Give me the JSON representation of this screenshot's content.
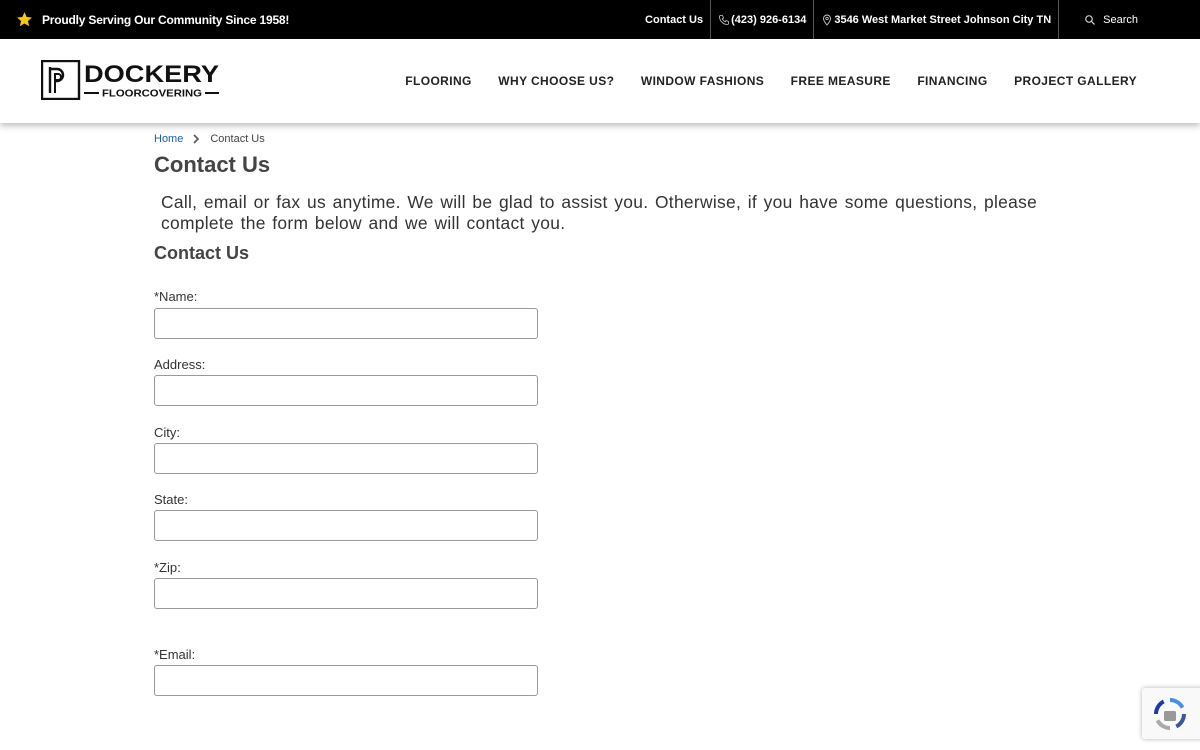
{
  "topbar": {
    "tagline": "Proudly Serving Our Community Since 1958!",
    "contact_link": "Contact Us",
    "phone": "(423) 926-6134",
    "address": "3546 West Market Street Johnson City TN",
    "search_label": "Search"
  },
  "logo": {
    "name": "DOCKERY",
    "tagline": "FLOORCOVERING"
  },
  "nav": {
    "items": [
      {
        "label": "FLOORING"
      },
      {
        "label": "WHY CHOOSE US?"
      },
      {
        "label": "WINDOW FASHIONS"
      },
      {
        "label": "FREE MEASURE"
      },
      {
        "label": "FINANCING"
      },
      {
        "label": "PROJECT GALLERY"
      }
    ]
  },
  "breadcrumb": {
    "home": "Home",
    "current": "Contact Us"
  },
  "page_title": "Contact Us",
  "intro_text": "Call, email or fax us anytime. We will be glad to assist you. Otherwise, if you have some questions, please complete the form below and we will contact you.",
  "form": {
    "heading": "Contact Us",
    "fields": [
      {
        "label": "*Name:",
        "value": ""
      },
      {
        "label": "Address:",
        "value": ""
      },
      {
        "label": "City:",
        "value": ""
      },
      {
        "label": "State:",
        "value": ""
      },
      {
        "label": "*Zip:",
        "value": ""
      },
      {
        "label": "*Email:",
        "value": ""
      }
    ]
  },
  "colors": {
    "topbar_bg": "#000000",
    "star": "#f5c518",
    "link": "#1a5ea8"
  }
}
